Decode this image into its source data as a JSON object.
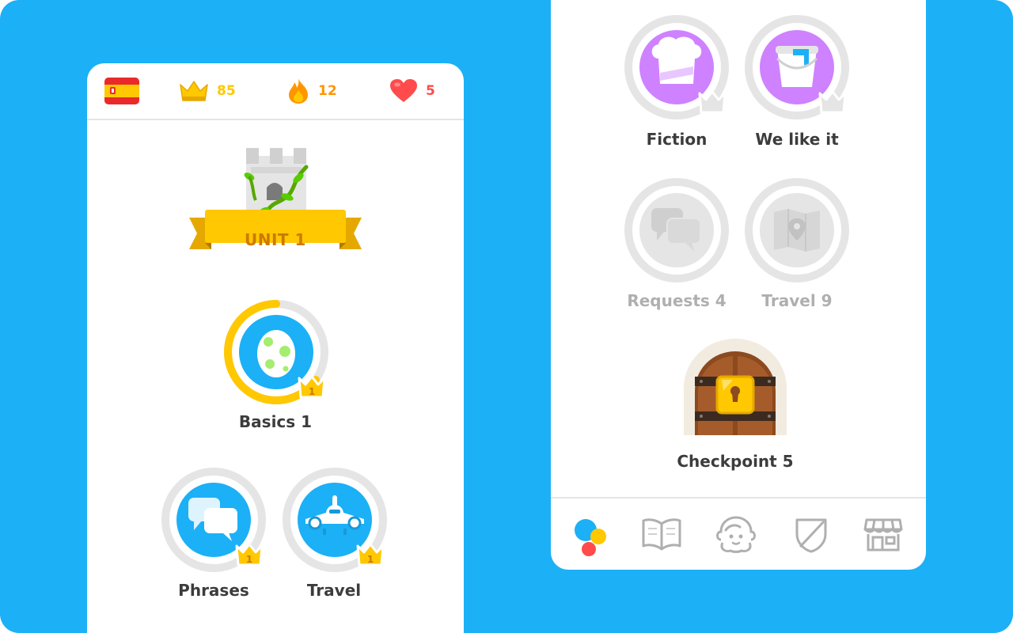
{
  "colors": {
    "background_blue": "#1cb0f6",
    "gold": "#ffc800",
    "orange": "#ff9600",
    "red": "#ff4b4b",
    "purple": "#ce82ff",
    "locked_gray": "#e5e5e5",
    "text_dark": "#3c3c3c",
    "text_locked": "#afafaf"
  },
  "header": {
    "flag_icon": "spain-flag-icon",
    "crowns": "85",
    "streak": "12",
    "hearts": "5"
  },
  "unit": {
    "label": "UNIT 1",
    "icon": "castle-tower-icon"
  },
  "left_skills": [
    {
      "label": "Basics 1",
      "icon": "egg-icon",
      "crown_level": "1",
      "progress": 0.55
    },
    {
      "label": "Phrases",
      "icon": "speech-bubbles-icon",
      "crown_level": "1"
    },
    {
      "label": "Travel",
      "icon": "airplane-icon",
      "crown_level": "1"
    }
  ],
  "right_skills": [
    {
      "label": "Fiction",
      "icon": "chef-hat-icon",
      "state": "available"
    },
    {
      "label": "We like it",
      "icon": "paint-bucket-icon",
      "state": "available"
    },
    {
      "label": "Requests 4",
      "icon": "speech-bubbles-icon",
      "state": "locked"
    },
    {
      "label": "Travel 9",
      "icon": "map-pin-icon",
      "state": "locked"
    }
  ],
  "checkpoint": {
    "label": "Checkpoint 5",
    "icon": "locked-door-icon"
  },
  "bottom_nav": [
    {
      "name": "learn-icon",
      "active": true
    },
    {
      "name": "stories-book-icon",
      "active": false
    },
    {
      "name": "profile-avatar-icon",
      "active": false
    },
    {
      "name": "leagues-shield-icon",
      "active": false
    },
    {
      "name": "shop-icon",
      "active": false
    }
  ]
}
